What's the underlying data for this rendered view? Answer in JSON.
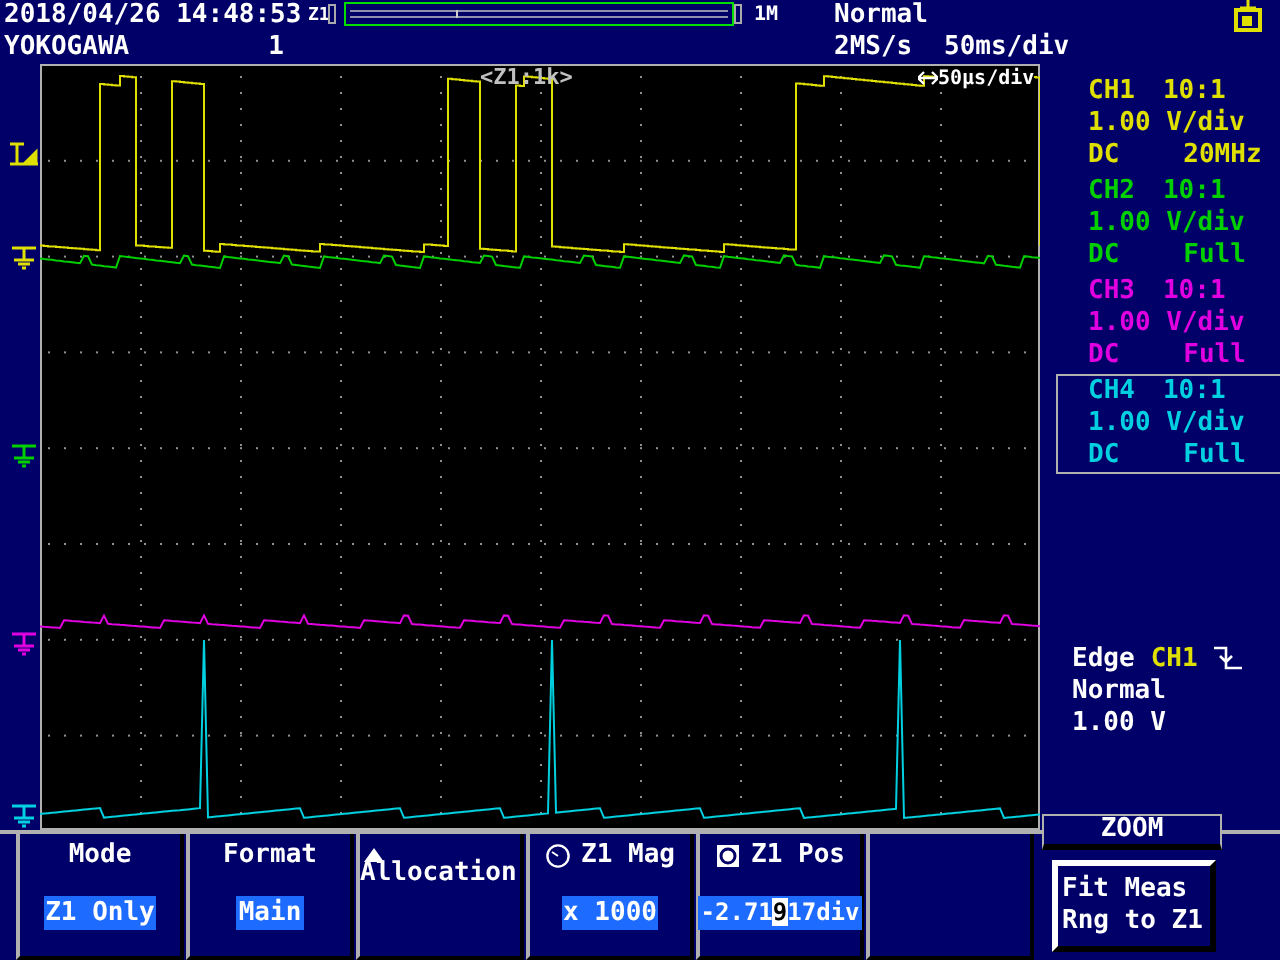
{
  "header": {
    "datetime": "2018/04/26 14:48:53",
    "zoom_marker": "Z1",
    "record_length": "1M",
    "brand": "YOKOGAWA",
    "acquisition_count": "1",
    "trigger_mode": "Normal",
    "sample_rate": "2MS/s",
    "timebase": "50ms/div"
  },
  "plot": {
    "zoom_window_label": "<Z1:1k>",
    "zoom_timebase": "50μs/div"
  },
  "channels": [
    {
      "name": "CH1",
      "probe": "10:1",
      "scale": "1.00 V/div",
      "coupling": "DC",
      "bandwidth": "20MHz",
      "color": "#e0e000",
      "selected": false
    },
    {
      "name": "CH2",
      "probe": "10:1",
      "scale": "1.00 V/div",
      "coupling": "DC",
      "bandwidth": "Full",
      "color": "#00d000",
      "selected": false
    },
    {
      "name": "CH3",
      "probe": "10:1",
      "scale": "1.00 V/div",
      "coupling": "DC",
      "bandwidth": "Full",
      "color": "#e000e0",
      "selected": false
    },
    {
      "name": "CH4",
      "probe": "10:1",
      "scale": "1.00 V/div",
      "coupling": "DC",
      "bandwidth": "Full",
      "color": "#00d0e0",
      "selected": true
    }
  ],
  "trigger": {
    "type": "Edge",
    "source": "CH1",
    "mode": "Normal",
    "level": "1.00 V"
  },
  "softkeys": [
    {
      "kind": "select",
      "label": "Mode",
      "value": "Z1 Only"
    },
    {
      "kind": "select",
      "label": "Format",
      "value": "Main"
    },
    {
      "kind": "submenu",
      "label": "Allocation"
    },
    {
      "kind": "dial",
      "label": "Z1 Mag",
      "value": "x 1000"
    },
    {
      "kind": "push-dial",
      "label": "Z1 Pos",
      "value": {
        "before_cursor": "-2.71",
        "at_cursor": "9",
        "after_cursor": "17div"
      }
    },
    {
      "kind": "empty"
    }
  ],
  "zoom_panel": {
    "title": "ZOOM",
    "button": "Fit Meas Rng to Z1"
  }
}
